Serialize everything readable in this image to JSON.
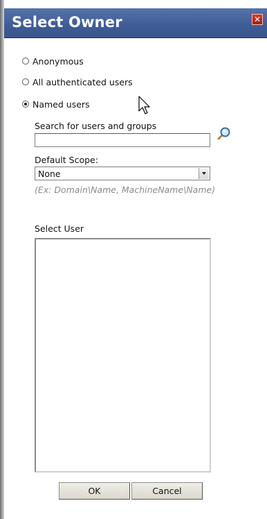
{
  "dialog": {
    "title": "Select Owner",
    "close_label": "✕"
  },
  "radios": [
    {
      "label": "Anonymous",
      "checked": false
    },
    {
      "label": "All authenticated users",
      "checked": false
    },
    {
      "label": "Named users",
      "checked": true
    }
  ],
  "search": {
    "label": "Search for users and groups",
    "value": ""
  },
  "scope": {
    "label": "Default Scope:",
    "selected": "None",
    "hint": "(Ex: Domain\\Name, MachineName\\Name)"
  },
  "select_user": {
    "label": "Select User"
  },
  "buttons": {
    "ok": "OK",
    "cancel": "Cancel"
  },
  "icons": {
    "search": "magnifier-icon",
    "close": "close-icon"
  }
}
